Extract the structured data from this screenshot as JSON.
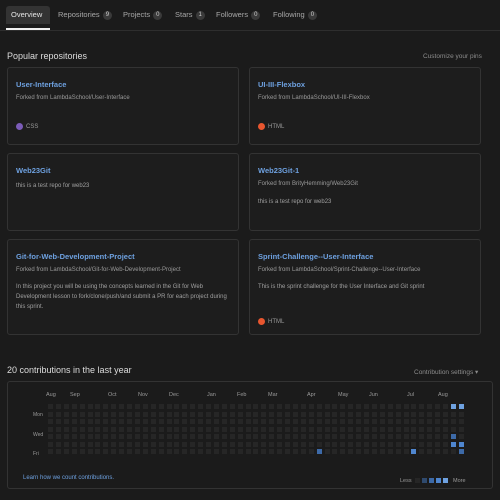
{
  "tabs": [
    {
      "label": "Overview",
      "count": ""
    },
    {
      "label": "Repositories",
      "count": "9"
    },
    {
      "label": "Projects",
      "count": "0"
    },
    {
      "label": "Stars",
      "count": "1"
    },
    {
      "label": "Followers",
      "count": "0"
    },
    {
      "label": "Following",
      "count": "0"
    }
  ],
  "popular": {
    "title": "Popular repositories",
    "customize": "Customize your pins",
    "repos": [
      {
        "name": "User-Interface",
        "fork": "Forked from LambdaSchool/User-Interface",
        "desc": "",
        "lang": "CSS",
        "lang_color": "#7b5cb8"
      },
      {
        "name": "UI-III-Flexbox",
        "fork": "Forked from LambdaSchool/UI-III-Flexbox",
        "desc": "",
        "lang": "HTML",
        "lang_color": "#e8562f"
      },
      {
        "name": "Web23Git",
        "fork": "",
        "desc": "this is a test repo for web23",
        "lang": "",
        "lang_color": ""
      },
      {
        "name": "Web23Git-1",
        "fork": "Forked from BrityHemming/Web23Git",
        "desc": "this is a test repo for web23",
        "lang": "",
        "lang_color": ""
      },
      {
        "name": "Git-for-Web-Development-Project",
        "fork": "Forked from LambdaSchool/Git-for-Web-Development-Project",
        "desc": "In this project you will be using the concepts learned in the Git for Web Development lesson to fork/clone/push/and submit a PR for each project during this sprint.",
        "lang": "",
        "lang_color": ""
      },
      {
        "name": "Sprint-Challenge--User-Interface",
        "fork": "Forked from LambdaSchool/Sprint-Challenge--User-Interface",
        "desc": "This is the sprint challenge for the User Interface and Git sprint",
        "lang": "HTML",
        "lang_color": "#e8562f"
      }
    ]
  },
  "contributions": {
    "title": "20 contributions in the last year",
    "settings": "Contribution settings ▾",
    "months": [
      "Aug",
      "Sep",
      "Oct",
      "Nov",
      "Dec",
      "Jan",
      "Feb",
      "Mar",
      "Apr",
      "May",
      "Jun",
      "Jul",
      "Aug"
    ],
    "days": [
      "Mon",
      "Wed",
      "Fri"
    ],
    "legend_less": "Less",
    "legend_more": "More",
    "learn": "Learn how we count contributions.",
    "colors": {
      "empty": "#262626",
      "l1": "#2f4a6e",
      "l2": "#3d6aa8",
      "l3": "#4f86cf",
      "l4": "#6ea1e0"
    }
  }
}
